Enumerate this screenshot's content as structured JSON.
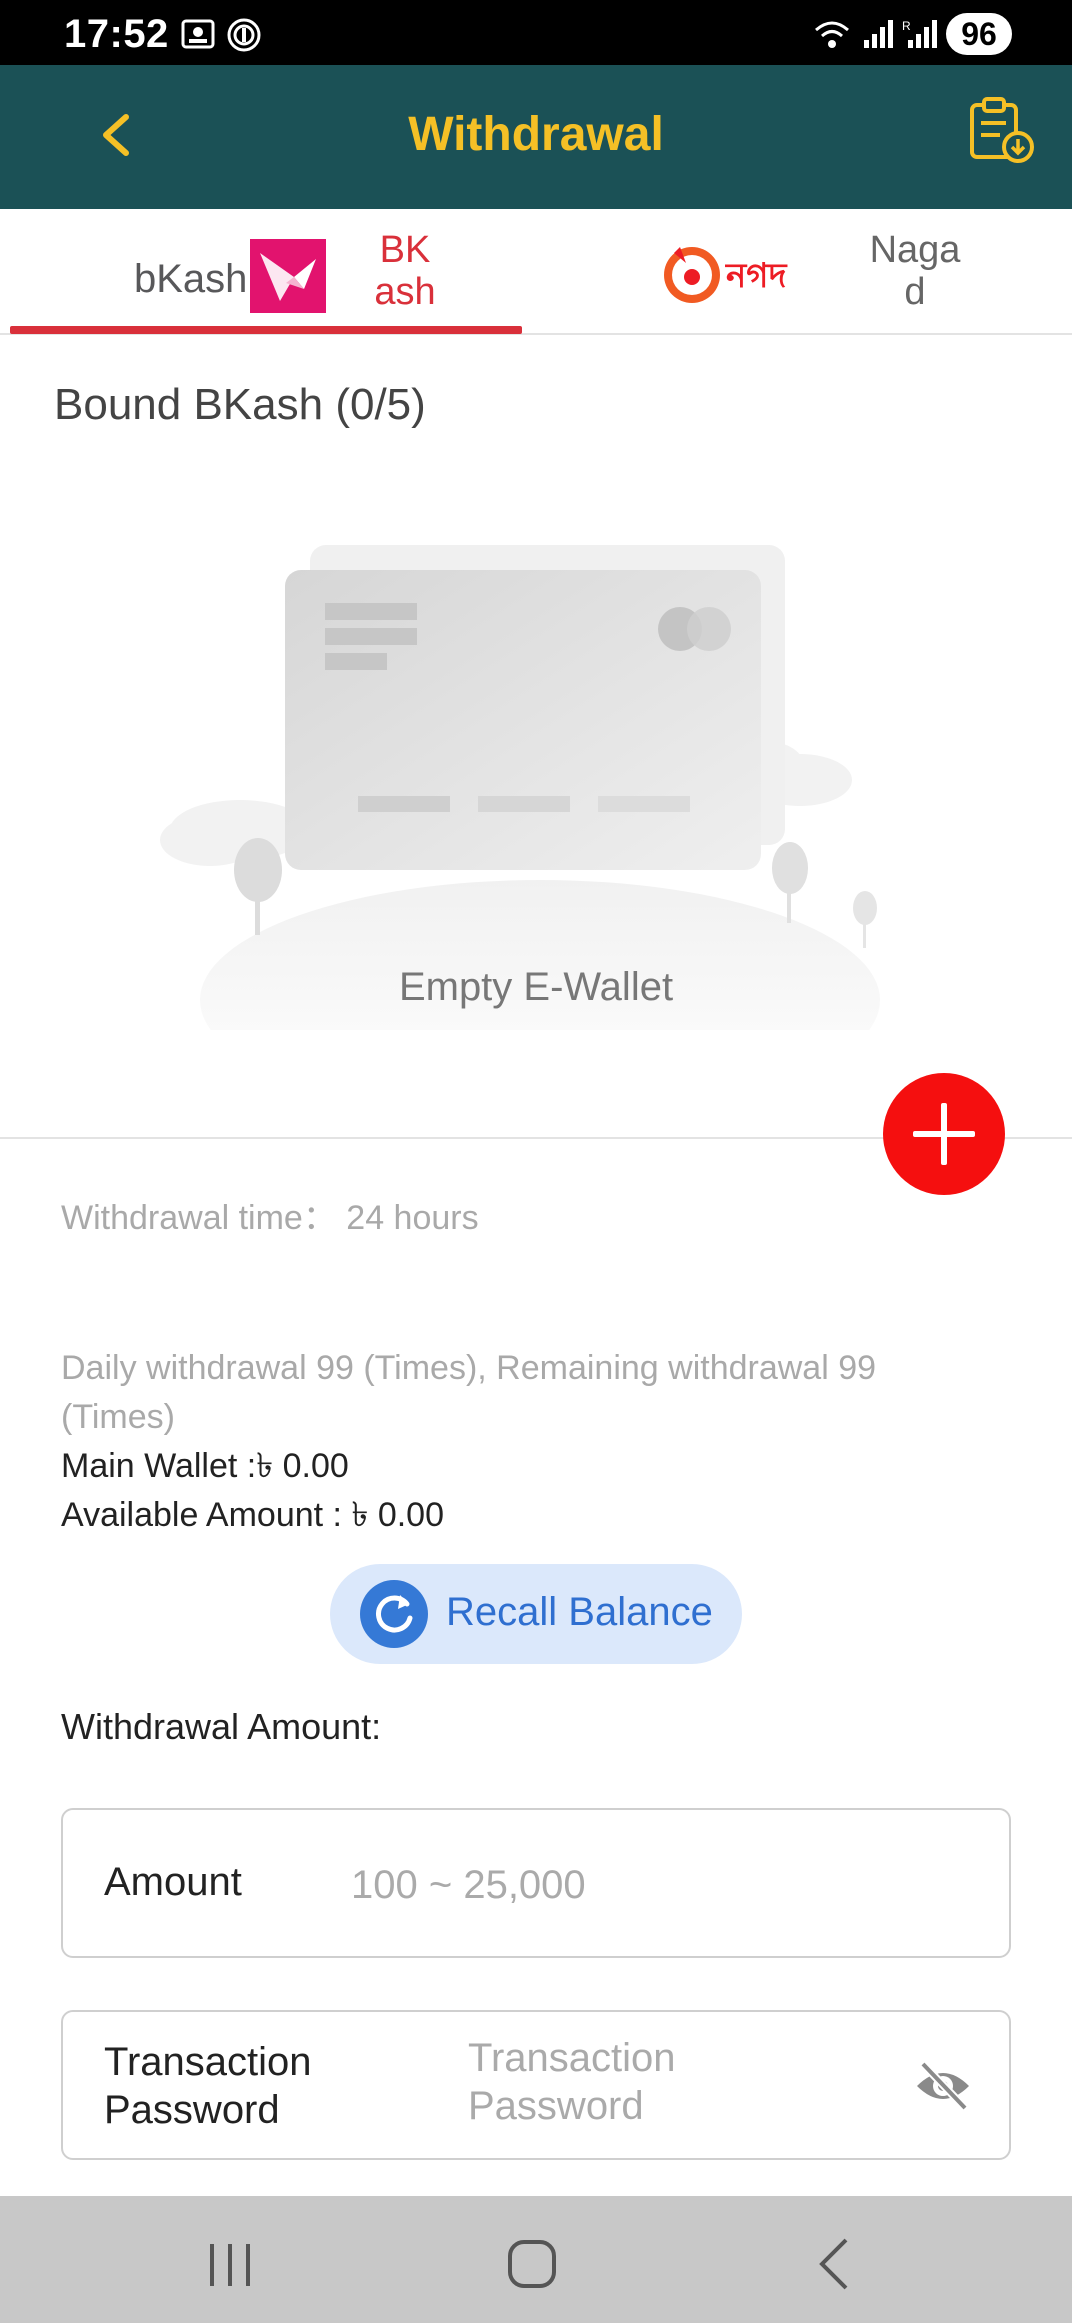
{
  "status_bar": {
    "time": "17:52",
    "battery": "96",
    "network_label": "R"
  },
  "header": {
    "title": "Withdrawal",
    "colors": {
      "background": "#1b5156",
      "title": "#f5c026"
    }
  },
  "tabs": [
    {
      "logo_text": "bKash",
      "label": "BK\nash",
      "active": true
    },
    {
      "logo_text": "নগদ",
      "label": "Naga\nd",
      "active": false
    }
  ],
  "wallet": {
    "section_title": "Bound BKash (0/5)",
    "empty_text": "Empty E-Wallet"
  },
  "info": {
    "withdrawal_time": "Withdrawal time：  24 hours",
    "daily_limit": "Daily withdrawal 99 (Times), Remaining withdrawal 99 (Times)",
    "main_wallet": "Main Wallet :৳ 0.00",
    "available_amount": "Available Amount : ৳ 0.00"
  },
  "recall_button": {
    "label": "Recall Balance"
  },
  "form": {
    "section_label": "Withdrawal Amount:",
    "amount": {
      "label": "Amount",
      "placeholder": "100 ~ 25,000",
      "value": ""
    },
    "password": {
      "label": "Transaction Password",
      "placeholder": "Transaction Password",
      "value": ""
    }
  },
  "colors": {
    "accent_red": "#d9303a",
    "add_button": "#f50f0f",
    "recall_bg": "#dbe8fb",
    "recall_text": "#2f6fd0"
  }
}
